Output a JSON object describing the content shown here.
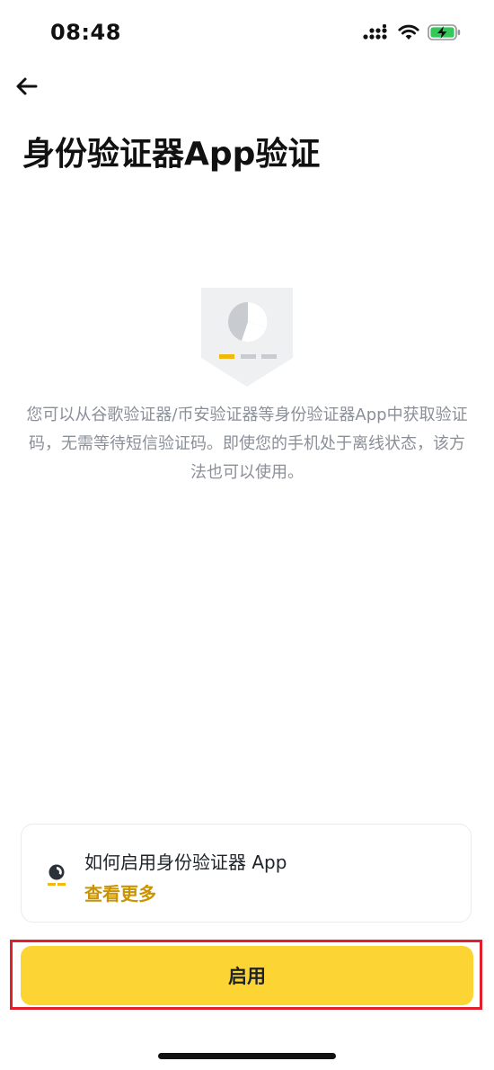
{
  "status_bar": {
    "time": "08:48",
    "icons": [
      "cellular-signal-icon",
      "wifi-icon",
      "battery-charging-icon"
    ]
  },
  "header": {
    "back_icon": "arrow-left-icon",
    "title": "身份验证器App验证"
  },
  "illustration": {
    "icon": "authenticator-shield-illustration"
  },
  "description": "您可以从谷歌验证器/币安验证器等身份验证器App中获取验证码，无需等待短信验证码。即使您的手机处于离线状态，该方法也可以使用。",
  "help_card": {
    "icon": "authenticator-guide-icon",
    "title": "如何启用身份验证器 App",
    "link_label": "查看更多"
  },
  "primary_action": {
    "label": "启用"
  },
  "colors": {
    "accent_yellow": "#fcd535",
    "link_gold": "#c99400",
    "text_primary": "#1e2329",
    "text_secondary": "#8a8f98",
    "highlight_red": "#e0202a"
  }
}
